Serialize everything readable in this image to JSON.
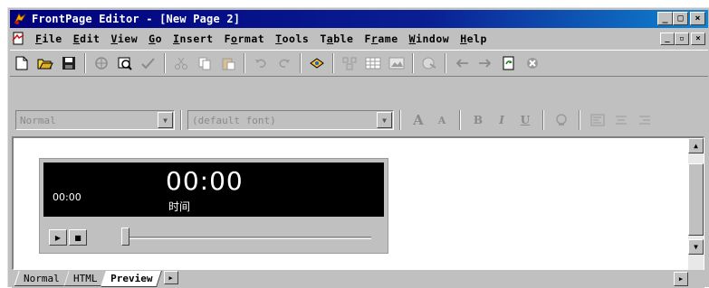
{
  "window": {
    "title": "FrontPage Editor - [New Page 2]",
    "controls": {
      "minimize": "_",
      "maximize": "□",
      "close": "×"
    }
  },
  "menubar": {
    "items": [
      {
        "label": "File",
        "u": "F",
        "rest": "ile"
      },
      {
        "label": "Edit",
        "u": "E",
        "rest": "dit"
      },
      {
        "label": "View",
        "u": "V",
        "rest": "iew"
      },
      {
        "label": "Go",
        "u": "G",
        "rest": "o"
      },
      {
        "label": "Insert",
        "u": "I",
        "rest": "nsert"
      },
      {
        "label": "Format",
        "pre": "F",
        "u": "o",
        "rest": "rmat"
      },
      {
        "label": "Tools",
        "u": "T",
        "rest": "ools"
      },
      {
        "label": "Table",
        "pre": "T",
        "u": "a",
        "rest": "ble"
      },
      {
        "label": "Frame",
        "pre": "F",
        "u": "r",
        "rest": "ame"
      },
      {
        "label": "Window",
        "u": "W",
        "rest": "indow"
      },
      {
        "label": "Help",
        "u": "H",
        "rest": "elp"
      }
    ],
    "doc_controls": {
      "minimize": "_",
      "restore": "▫",
      "close": "×"
    }
  },
  "standard_toolbar": {
    "icons": [
      "new-page-icon",
      "open-icon",
      "save-icon",
      "publish-icon",
      "preview-in-browser-icon",
      "spelling-icon",
      "cut-icon",
      "copy-icon",
      "paste-icon",
      "undo-icon",
      "redo-icon",
      "web-bot-icon",
      "insert-component-icon",
      "insert-table-icon",
      "insert-image-icon",
      "hyperlink-icon",
      "back-icon",
      "forward-icon",
      "refresh-icon",
      "stop-icon"
    ]
  },
  "format_toolbar": {
    "style_value": "Normal",
    "font_value": "(default font)",
    "buttons": {
      "increase_font": "A",
      "decrease_font": "A",
      "bold": "B",
      "italic": "I",
      "underline": "U"
    }
  },
  "media_player": {
    "elapsed": "00:00",
    "big_time": "00:00",
    "time_label": "时间",
    "position": 0
  },
  "tabs": {
    "items": [
      "Normal",
      "HTML",
      "Preview"
    ],
    "active": "Preview"
  }
}
